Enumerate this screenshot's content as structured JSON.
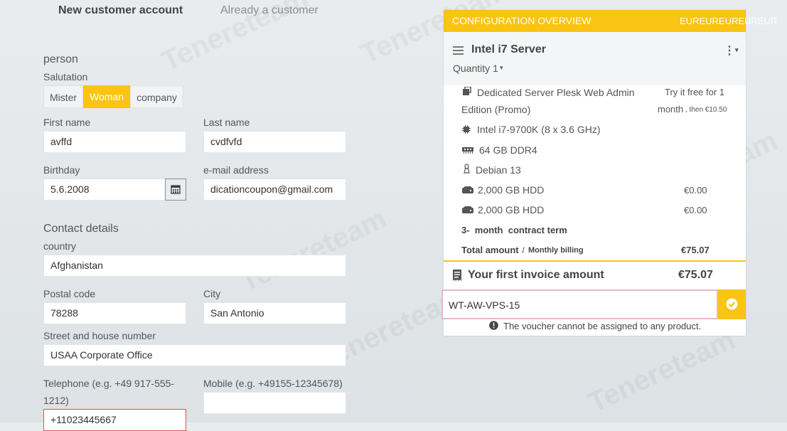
{
  "tabs": {
    "new_customer": "New customer account",
    "already_customer": "Already a customer"
  },
  "person": {
    "section_title": "person",
    "salutation_label": "Salutation",
    "salutation_options": [
      "Mister",
      "Woman",
      "company"
    ],
    "salutation_selected": "Woman",
    "first_name_label": "First name",
    "first_name_value": "avffd",
    "last_name_label": "Last name",
    "last_name_value": "cvdfvfd",
    "birthday_label": "Birthday",
    "birthday_value": "5.6.2008",
    "email_label": "e-mail address",
    "email_value": "dicationcoupon@gmail.com"
  },
  "contact": {
    "section_title": "Contact details",
    "country_label": "country",
    "country_value": "Afghanistan",
    "postal_label": "Postal code",
    "postal_value": "78288",
    "city_label": "City",
    "city_value": "San Antonio",
    "street_label": "Street and house number",
    "street_value": "USAA Corporate Office",
    "telephone_label_line1": "Telephone (e.g. +49 917-555-",
    "telephone_label_line2": "1212)",
    "telephone_value": "+11023445667",
    "mobile_label": "Mobile (e.g. +49155-12345678)",
    "mobile_value": ""
  },
  "config": {
    "header_title": "CONFIGURATION OVERVIEW",
    "currency_text": "EUREUREUREUREUR",
    "server_name": "Intel i7 Server",
    "quantity_label": "Quantity",
    "quantity_value": "1",
    "items": [
      {
        "icon": "plesk-icon",
        "line1": "Dedicated Server Plesk Web Admin",
        "line2": "Edition (Promo)",
        "price_line1": "Try it free for 1",
        "price_line2a": "month",
        "price_line2b": ", then €10.50"
      },
      {
        "icon": "cpu-icon",
        "text": "Intel i7-9700K (8 x 3.6 GHz)"
      },
      {
        "icon": "ram-icon",
        "text": "64 GB DDR4"
      },
      {
        "icon": "linux-icon",
        "text": "Debian 13"
      },
      {
        "icon": "hdd-icon",
        "text": "2,000 GB HDD",
        "price": "€0.00"
      },
      {
        "icon": "hdd-icon",
        "text": "2,000 GB HDD",
        "price": "€0.00"
      }
    ],
    "contract_term": "3-  month  contract term",
    "total_label": "Total amount",
    "total_sep": " / ",
    "billing_label": "Monthly billing",
    "total_value": "€75.07",
    "invoice_label": "Your first invoice amount",
    "invoice_value": "€75.07",
    "voucher_value": "WT-AW-VPS-15",
    "voucher_error": "The voucher cannot be assigned to any product."
  },
  "watermark": "Tenereteam",
  "colors": {
    "accent": "#f9c412",
    "error": "#d9534f",
    "voucher_border": "#eab8c4"
  }
}
